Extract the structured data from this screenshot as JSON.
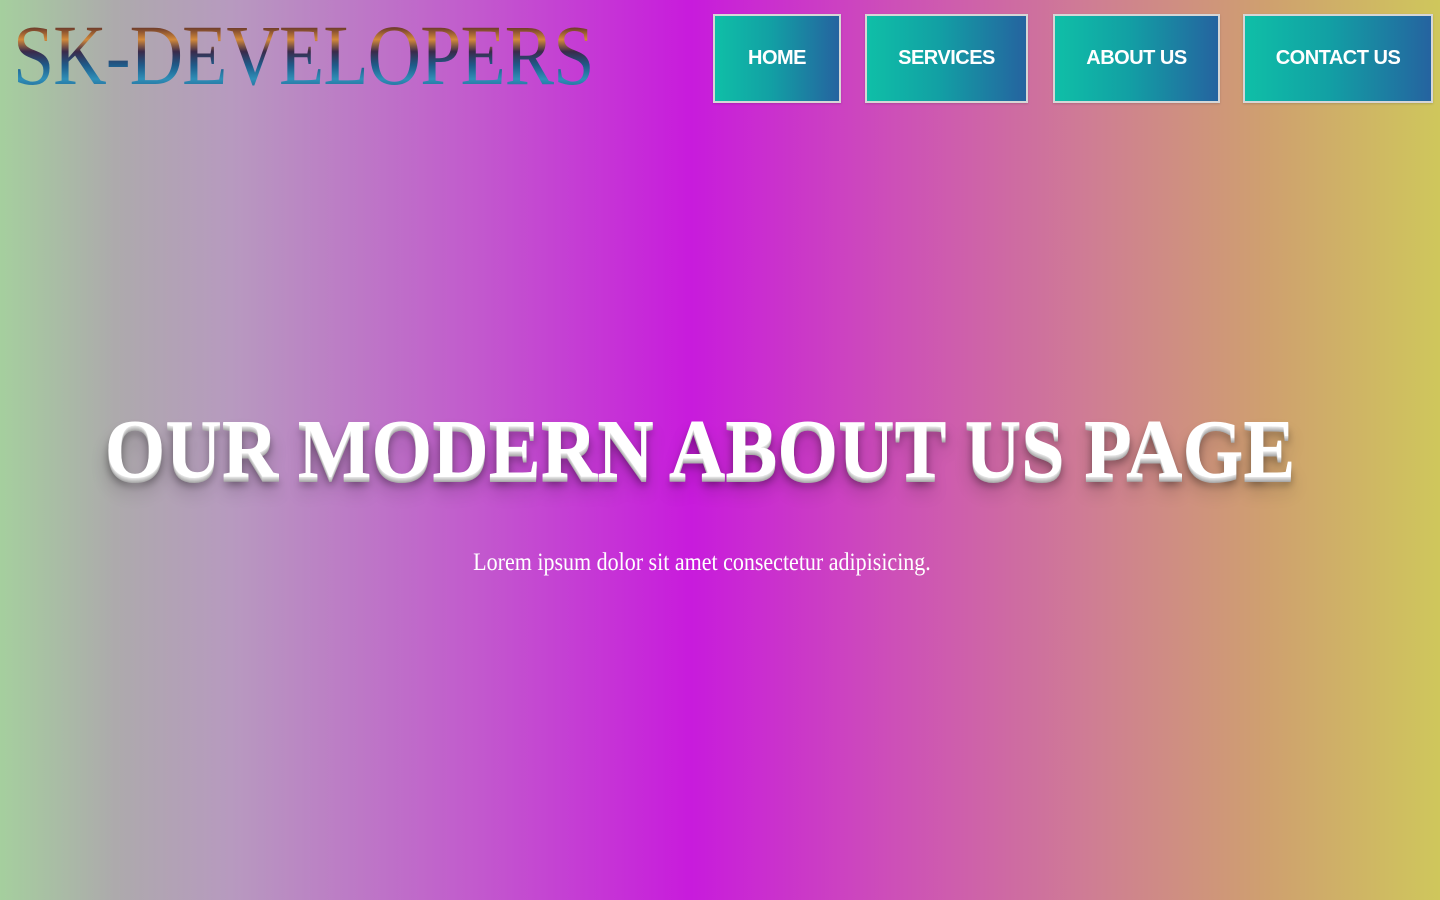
{
  "header": {
    "logo_text": "SK-DEVELOPERS",
    "nav": {
      "home": "HOME",
      "services": "SERVICES",
      "about": "ABOUT US",
      "contact": "CONTACT US"
    }
  },
  "hero": {
    "title": "OUR MODERN ABOUT US PAGE",
    "subtitle": "Lorem ipsum dolor sit amet consectetur adipisicing."
  },
  "colors": {
    "nav_gradient_start": "#0fbfa7",
    "nav_gradient_end": "#2563a0",
    "hero_text": "#ffffff",
    "background_center": "#c81bdc"
  }
}
